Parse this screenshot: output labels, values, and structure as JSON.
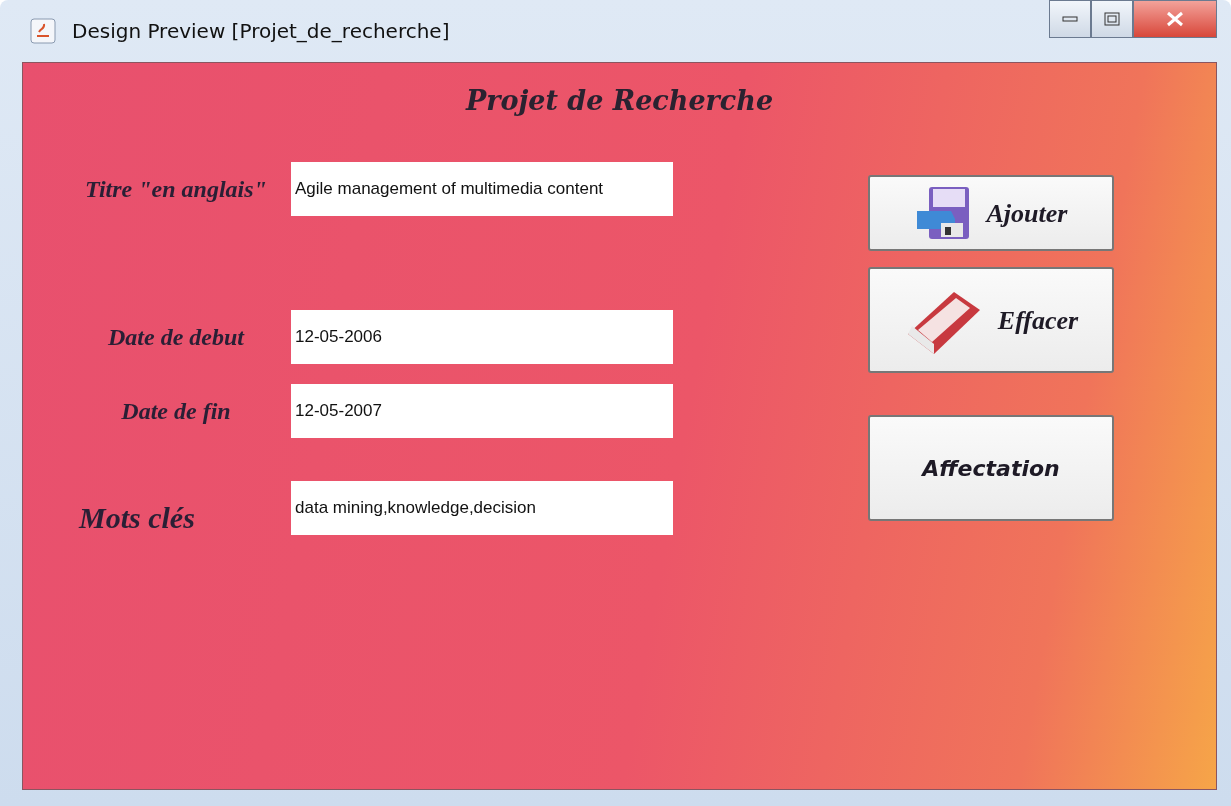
{
  "window": {
    "title": "Design Preview [Projet_de_recherche]"
  },
  "heading": "Projet de Recherche",
  "fields": [
    {
      "label": "Titre \"en anglais\"",
      "value": "Agile management of multimedia content"
    },
    {
      "label": "Date de debut",
      "value": "12-05-2006"
    },
    {
      "label": "Date de fin",
      "value": "12-05-2007"
    },
    {
      "label": "Mots clés",
      "value": "data mining,knowledge,decision"
    }
  ],
  "buttons": [
    {
      "label": "Ajouter",
      "kind": "save"
    },
    {
      "label": "Effacer",
      "kind": "eraser"
    },
    {
      "label": "Affectation",
      "kind": "text"
    }
  ]
}
